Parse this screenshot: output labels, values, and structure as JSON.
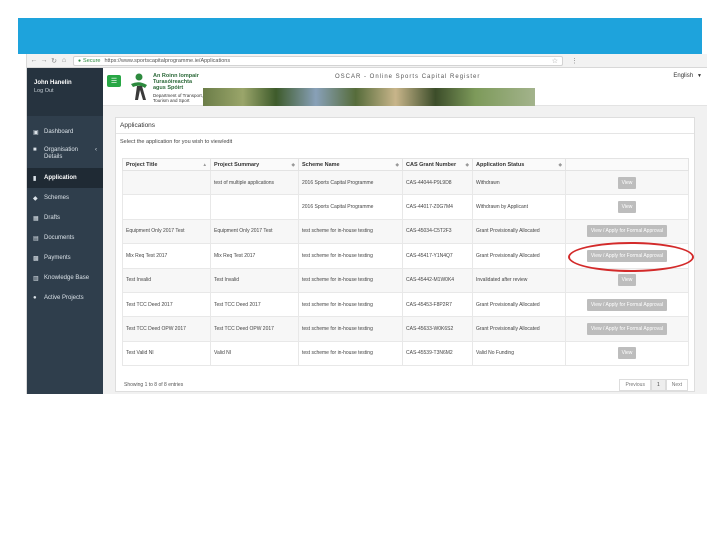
{
  "browser": {
    "secure_label": "Secure",
    "url": "https://www.sportscapitalprogramme.ie/Applications"
  },
  "sidebar": {
    "user_name": "John Hanelin",
    "logout": "Log Out",
    "items": [
      {
        "label": "Dashboard",
        "icon": "dashboard-icon"
      },
      {
        "label": "Organisation Details",
        "icon": "building-icon"
      },
      {
        "label": "Application",
        "icon": "file-icon"
      },
      {
        "label": "Schemes",
        "icon": "schemes-icon"
      },
      {
        "label": "Drafts",
        "icon": "drafts-icon"
      },
      {
        "label": "Documents",
        "icon": "documents-icon"
      },
      {
        "label": "Payments",
        "icon": "payments-icon"
      },
      {
        "label": "Knowledge Base",
        "icon": "book-icon"
      },
      {
        "label": "Active Projects",
        "icon": "pin-icon"
      }
    ]
  },
  "header": {
    "logo_text": "An Roinn Iompair Turasóireachta agus Spóirt",
    "logo_sub": "Department of Transport, Tourism and Sport",
    "app_title": "OSCAR - Online Sports Capital Register",
    "language": "English"
  },
  "card": {
    "title": "Applications",
    "hint": "Select the application for you wish to view/edit"
  },
  "table": {
    "headers": [
      "Project Title",
      "Project Summary",
      "Scheme Name",
      "CAS Grant Number",
      "Application Status",
      ""
    ],
    "rows": [
      {
        "title": "",
        "summary": "test of multiple applications",
        "scheme": "2016 Sports Capital Programme",
        "cas": "CAS-44044-P9L9D8",
        "status": "Withdrawn",
        "action": "View"
      },
      {
        "title": "",
        "summary": "",
        "scheme": "2016 Sports Capital Programme",
        "cas": "CAS-44017-Z0G7M4",
        "status": "Withdrawn by Applicant",
        "action": "View"
      },
      {
        "title": "Equipment Only 2017 Test",
        "summary": "Equipment Only 2017 Test",
        "scheme": "test scheme for in-house testing",
        "cas": "CAS-45034-C5T2F3",
        "status": "Grant Provisionally Allocated",
        "action": "View / Apply for Formal Approval"
      },
      {
        "title": "Mix Req Test 2017",
        "summary": "Mix Req Test 2017",
        "scheme": "test scheme for in-house testing",
        "cas": "CAS-45417-Y1N4Q7",
        "status": "Grant Provisionally Allocated",
        "action": "View / Apply for Formal Approval"
      },
      {
        "title": "Test Invalid",
        "summary": "Test Invalid",
        "scheme": "test scheme for in-house testing",
        "cas": "CAS-45442-M1W0K4",
        "status": "Invalidated after review",
        "action": "View"
      },
      {
        "title": "Test TCC Deed 2017",
        "summary": "Test TCC Deed 2017",
        "scheme": "test scheme for in-house testing",
        "cas": "CAS-45453-F8P2R7",
        "status": "Grant Provisionally Allocated",
        "action": "View / Apply for Formal Approval"
      },
      {
        "title": "Test TCC Deed OPW 2017",
        "summary": "Test TCC Deed OPW 2017",
        "scheme": "test scheme for in-house testing",
        "cas": "CAS-45633-W0K6S2",
        "status": "Grant Provisionally Allocated",
        "action": "View / Apply for Formal Approval"
      },
      {
        "title": "Test Valid NI",
        "summary": "Valid NI",
        "scheme": "test scheme for in-house testing",
        "cas": "CAS-45539-T3N6M2",
        "status": "Valid No Funding",
        "action": "View"
      }
    ]
  },
  "footer": {
    "info": "Showing 1 to 8 of 8 entries",
    "prev": "Previous",
    "page": "1",
    "next": "Next"
  },
  "annotation_color": "#d32a2a"
}
